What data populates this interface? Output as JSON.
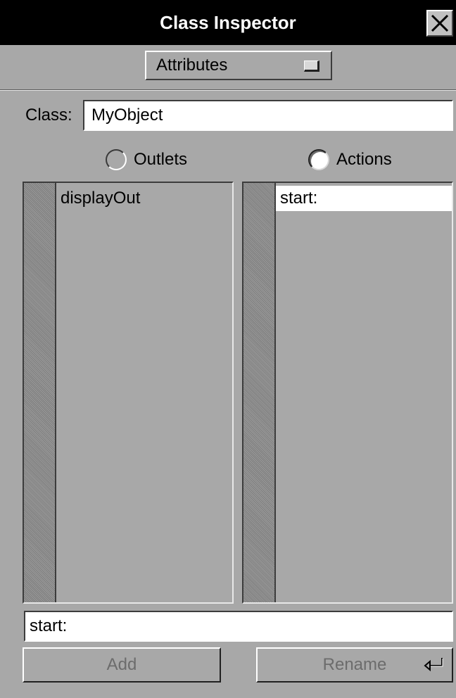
{
  "window": {
    "title": "Class Inspector"
  },
  "popup": {
    "selected": "Attributes"
  },
  "class_row": {
    "label": "Class:",
    "value": "MyObject"
  },
  "radios": [
    {
      "label": "Outlets",
      "selected": false
    },
    {
      "label": "Actions",
      "selected": true
    }
  ],
  "outlets": {
    "items": [
      "displayOut"
    ]
  },
  "actions": {
    "items": [
      "start:"
    ],
    "selected_index": 0
  },
  "name_field": {
    "value": "start:"
  },
  "buttons": {
    "add": "Add",
    "rename": "Rename"
  },
  "colors": {
    "window_bg": "#a8a8a8",
    "title_bg": "#000000",
    "field_bg": "#ffffff",
    "disabled_text": "#6c6c6c"
  }
}
